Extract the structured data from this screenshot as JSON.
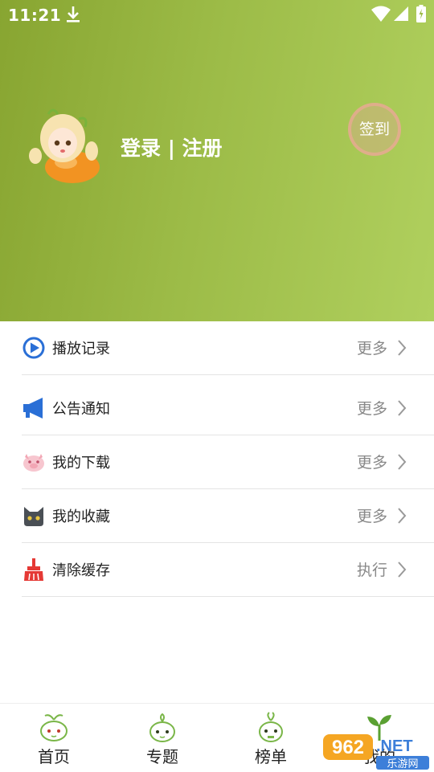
{
  "status_bar": {
    "time": "11:21"
  },
  "header": {
    "auth_label": "登录 | 注册",
    "signin_label": "签到",
    "gradient_start": "#88a531",
    "gradient_end": "#b0d05e"
  },
  "menu": {
    "items": [
      {
        "label": "播放记录",
        "action": "更多",
        "icon": "play-icon",
        "color": "#2a6fd6"
      },
      {
        "label": "公告通知",
        "action": "更多",
        "icon": "megaphone-icon",
        "color": "#2a6fd6"
      },
      {
        "label": "我的下载",
        "action": "更多",
        "icon": "pig-icon",
        "color": "#f2a6b4"
      },
      {
        "label": "我的收藏",
        "action": "更多",
        "icon": "cat-icon",
        "color": "#4a4f55"
      },
      {
        "label": "清除缓存",
        "action": "执行",
        "icon": "broom-icon",
        "color": "#e53935"
      }
    ]
  },
  "tabbar": {
    "tabs": [
      {
        "label": "首页",
        "icon": "sprout-mascot-icon"
      },
      {
        "label": "专题",
        "icon": "sprout-mascot-icon"
      },
      {
        "label": "榜单",
        "icon": "sprout-mascot-icon"
      },
      {
        "label": "我的",
        "icon": "sprout-leaf-icon"
      }
    ]
  },
  "watermark": {
    "line1": "962.NET",
    "line2": "乐游网"
  }
}
